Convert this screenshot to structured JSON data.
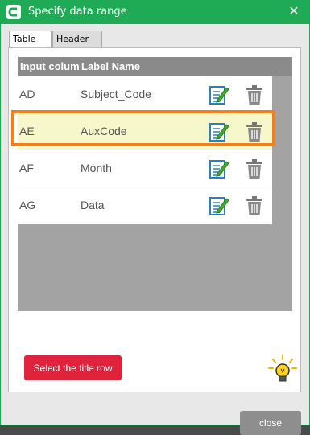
{
  "window": {
    "title": "Specify data range",
    "close_glyph": "✕",
    "accent": "#1faa55"
  },
  "tabs": [
    {
      "label": "Table",
      "active": true,
      "help_glyph": "?"
    },
    {
      "label": "Header",
      "active": false,
      "help_glyph": "?"
    }
  ],
  "grid": {
    "columns": [
      "Input colum",
      "Label Name"
    ],
    "rows": [
      {
        "code": "AD",
        "name": "Subject_Code"
      },
      {
        "code": "AE",
        "name": "AuxCode",
        "selected": true
      },
      {
        "code": "AF",
        "name": "Month"
      },
      {
        "code": "AG",
        "name": "Data"
      }
    ],
    "row_icons": [
      "edit-icon",
      "trash-icon"
    ],
    "highlight_color": "#f27f1b"
  },
  "buttons": {
    "select_title_row": "Select the title row",
    "close": "close"
  },
  "hint_icon": "lightbulb-icon"
}
